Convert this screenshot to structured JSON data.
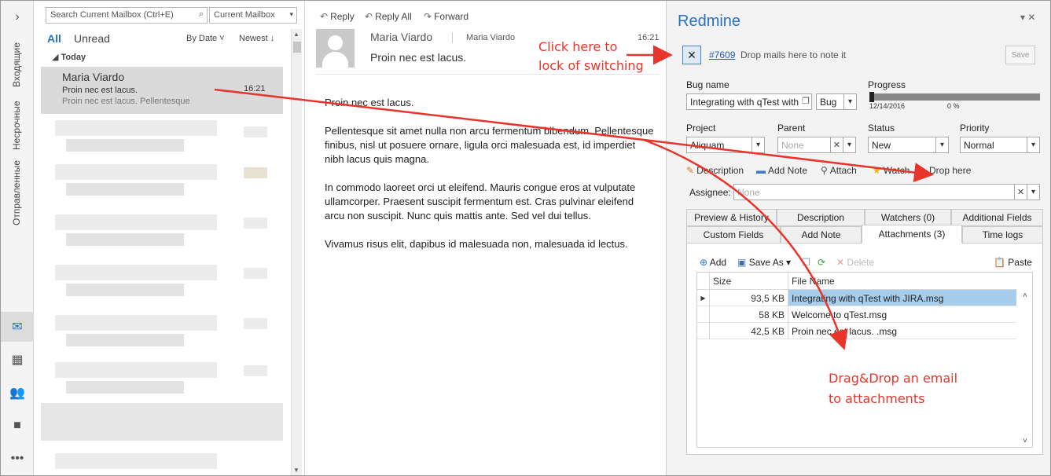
{
  "nav": {
    "expand_icon": "chevron-right-icon",
    "folders": [
      "Входящие",
      "Несрочные",
      "Отправленные"
    ],
    "bottom_icons": [
      "mail-icon",
      "calendar-icon",
      "people-icon",
      "tasks-icon",
      "more-icon"
    ]
  },
  "mail_list": {
    "search_placeholder": "Search Current Mailbox (Ctrl+E)",
    "scope": "Current Mailbox",
    "filter_all": "All",
    "filter_unread": "Unread",
    "sort_by": "By Date ˅",
    "sort_order": "Newest ↓",
    "group_header": "◢ Today",
    "selected": {
      "sender": "Maria Viardo",
      "subject": "Proin nec est lacus.",
      "preview": "Proin nec est lacus.    Pellentesque",
      "time": "16:21"
    }
  },
  "reading": {
    "reply": "Reply",
    "reply_all": "Reply All",
    "forward": "Forward",
    "sender": "Maria Viardo",
    "recipient": "Maria Viardo",
    "subject": "Proin nec est lacus.",
    "time": "16:21",
    "body": [
      "Proin nec est lacus.",
      "Pellentesque sit amet nulla non arcu fermentum bibendum. Pellentesque finibus, nisl ut posuere ornare, ligula orci malesuada est, id imperdiet nibh lacus quis magna.",
      "In commodo laoreet orci ut eleifend. Mauris congue eros at vulputate ullamcorper. Praesent suscipit fermentum est. Cras pulvinar eleifend arcu non suscipit. Nunc quis mattis ante. Sed vel dui tellus.",
      "Vivamus risus elit, dapibus id malesuada non, malesuada id lectus."
    ]
  },
  "redmine": {
    "title": "Redmine",
    "controls": "▾  ✕",
    "issue_link": "#7609",
    "drop_note": "Drop mails here to note it",
    "save": "Save",
    "bug_name_label": "Bug name",
    "bug_name_value": "Integrating with qTest with",
    "tracker": "Bug",
    "progress_label": "Progress",
    "progress_value": 0,
    "progress_date": "12/14/2016",
    "progress_pct": "0 %",
    "project_label": "Project",
    "project_value": "Aliquam",
    "parent_label": "Parent",
    "parent_value": "None",
    "status_label": "Status",
    "status_value": "New",
    "priority_label": "Priority",
    "priority_value": "Normal",
    "actions": {
      "description": "Description",
      "add_note": "Add Note",
      "attach": "Attach",
      "watch": "Watch",
      "drop_here": "Drop here"
    },
    "assignee_label": "Assignee:",
    "assignee_value": "None",
    "tabs_row1": [
      "Preview & History",
      "Description",
      "Watchers (0)",
      "Additional Fields"
    ],
    "tabs_row2": [
      "Custom Fields",
      "Add Note",
      "Attachments (3)",
      "Time logs"
    ],
    "toolbar": {
      "add": "Add",
      "save_as": "Save As ▾",
      "delete": "Delete",
      "paste": "Paste"
    },
    "grid_headers": [
      "Size",
      "File Name"
    ],
    "attachments": [
      {
        "size": "93,5 KB",
        "name": "Integrating with qTest with JIRA.msg"
      },
      {
        "size": "58 KB",
        "name": "Welcome to qTest.msg"
      },
      {
        "size": "42,5 KB",
        "name": "Proin nec est lacus. .msg"
      }
    ]
  },
  "annotations": {
    "lock_line1": "Click here to",
    "lock_line2": "lock of switching",
    "dragdrop_line1": "Drag&Drop an email",
    "dragdrop_line2": "to attachments",
    "color": "#e8352b"
  }
}
